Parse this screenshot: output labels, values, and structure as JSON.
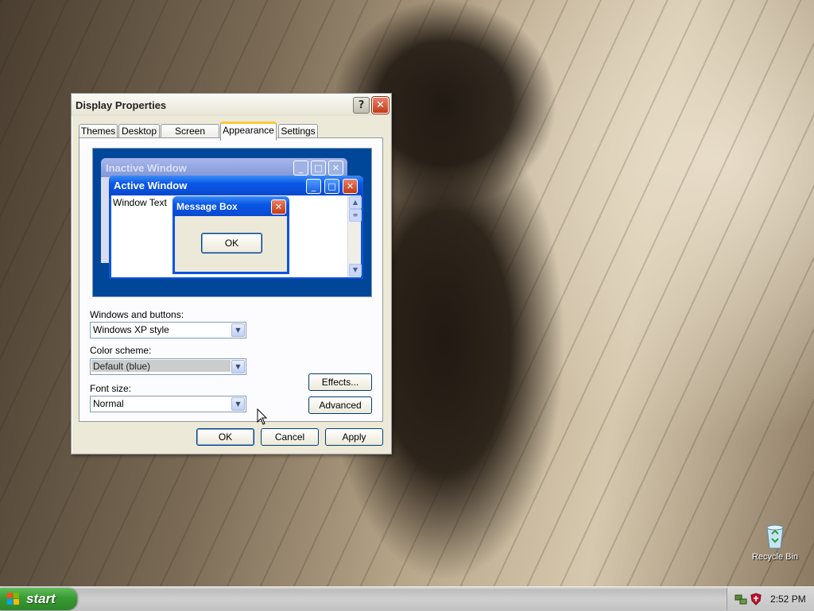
{
  "dialog": {
    "title": "Display Properties",
    "help_glyph": "?",
    "close_glyph": "✕",
    "tabs": [
      {
        "label": "Themes"
      },
      {
        "label": "Desktop"
      },
      {
        "label": "Screen Saver"
      },
      {
        "label": "Appearance",
        "active": true
      },
      {
        "label": "Settings"
      }
    ],
    "preview": {
      "inactive_title": "Inactive Window",
      "active_title": "Active Window",
      "window_text": "Window Text",
      "message_title": "Message Box",
      "message_ok": "OK"
    },
    "windows_buttons": {
      "label": "Windows and buttons:",
      "value": "Windows XP style"
    },
    "color_scheme": {
      "label": "Color scheme:",
      "value": "Default (blue)"
    },
    "font_size": {
      "label": "Font size:",
      "value": "Normal"
    },
    "effects_label": "Effects...",
    "advanced_label": "Advanced",
    "ok_label": "OK",
    "cancel_label": "Cancel",
    "apply_label": "Apply"
  },
  "desktop": {
    "recycle_bin_label": "Recycle Bin"
  },
  "taskbar": {
    "start_label": "start",
    "clock": "2:52 PM"
  },
  "colors": {
    "xp_blue": "#0a54e3",
    "start_green": "#3a9a33",
    "dialog_bg": "#ece9d8",
    "tab_accent": "#ffc83c"
  }
}
